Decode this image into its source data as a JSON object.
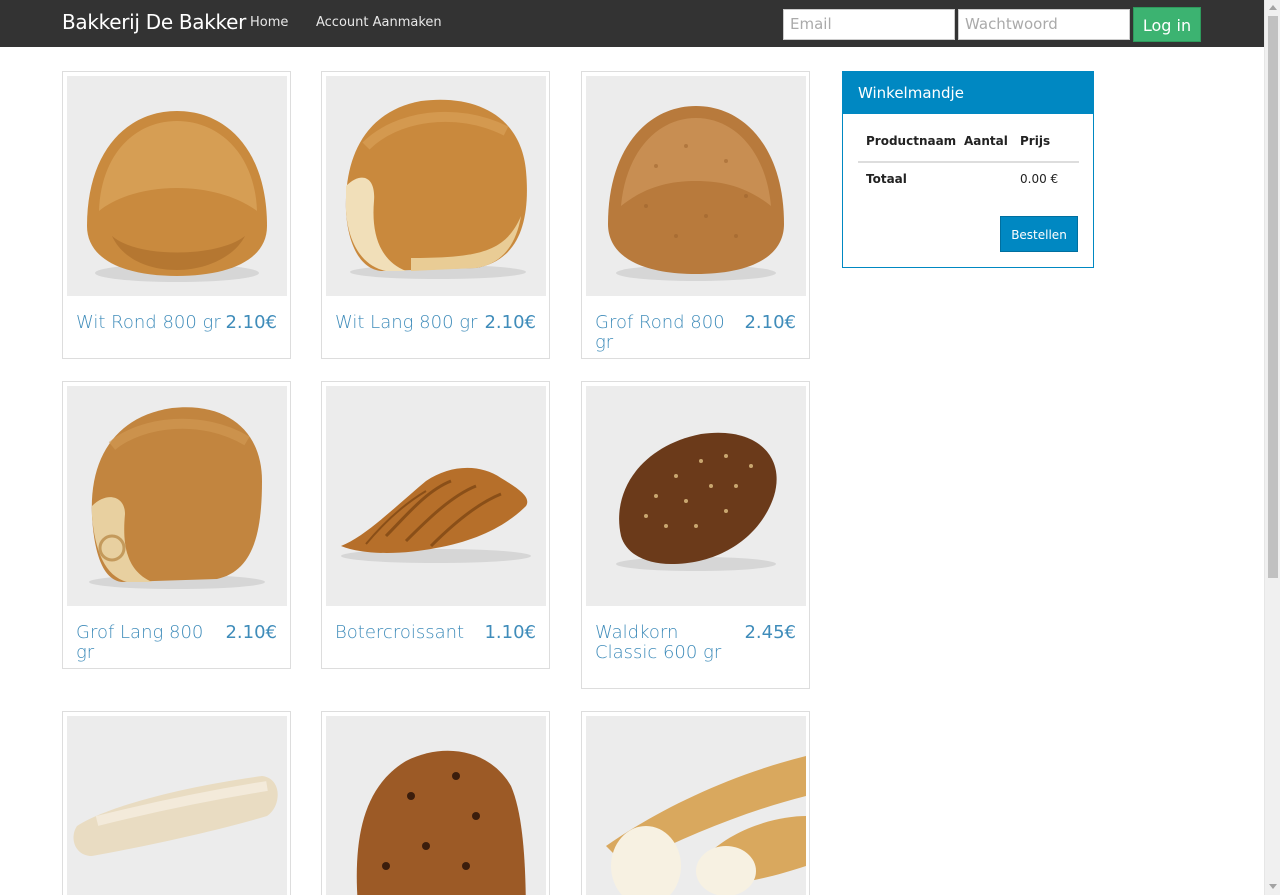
{
  "navbar": {
    "brand": "Bakkerij De Bakker",
    "links": [
      {
        "label": "Home"
      },
      {
        "label": "Account Aanmaken"
      }
    ],
    "email_placeholder": "Email",
    "password_placeholder": "Wachtwoord",
    "login_label": "Log in"
  },
  "products": [
    {
      "name": "Wit Rond 800 gr",
      "price": "2.10€",
      "image": "round-white-bread"
    },
    {
      "name": "Wit Lang 800 gr",
      "price": "2.10€",
      "image": "long-white-bread"
    },
    {
      "name": "Grof Rond 800 gr",
      "price": "2.10€",
      "image": "round-wholegrain-bread"
    },
    {
      "name": "Grof Lang 800 gr",
      "price": "2.10€",
      "image": "long-wholegrain-bread"
    },
    {
      "name": "Botercroissant",
      "price": "1.10€",
      "image": "croissant"
    },
    {
      "name": "Waldkorn Classic 600 gr",
      "price": "2.45€",
      "image": "seeded-dark-bread"
    },
    {
      "name": "",
      "price": "",
      "image": "ciabatta"
    },
    {
      "name": "",
      "price": "",
      "image": "raisin-bread"
    },
    {
      "name": "",
      "price": "",
      "image": "baguette"
    }
  ],
  "cart": {
    "title": "Winkelmandje",
    "columns": [
      "Productnaam",
      "Aantal",
      "Prijs"
    ],
    "total_label": "Totaal",
    "total_value": "0.00 €",
    "order_label": "Bestellen"
  },
  "colors": {
    "navbar_bg": "#333333",
    "accent": "#0088c2",
    "login_button": "#3cb371",
    "product_text": "#3f8cba"
  }
}
